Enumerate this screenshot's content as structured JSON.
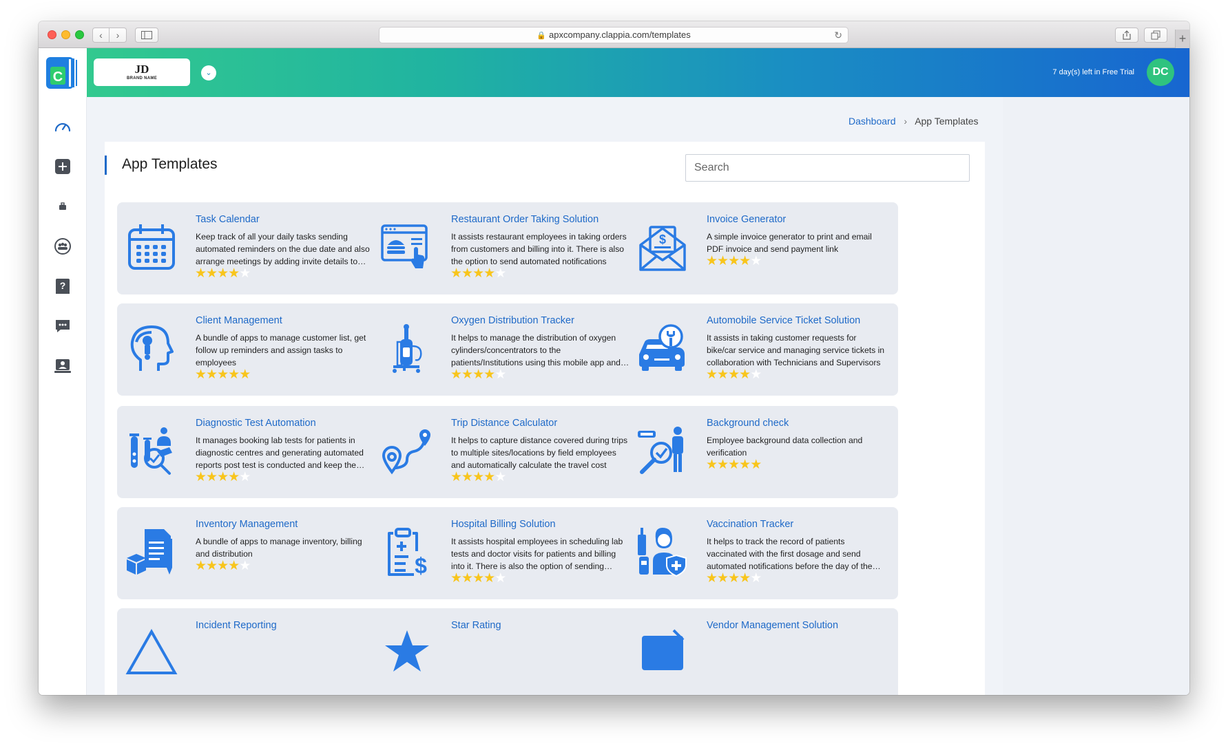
{
  "browser": {
    "url": "apxcompany.clappia.com/templates"
  },
  "header": {
    "brand_mark": "JD",
    "brand_name": "BRAND NAME",
    "trial_text": "7 day(s) left in Free Trial",
    "avatar_initials": "DC"
  },
  "breadcrumb": {
    "dashboard": "Dashboard",
    "current": "App Templates"
  },
  "main": {
    "title": "App Templates",
    "search_placeholder": "Search"
  },
  "colors": {
    "accent": "#1f6ac8",
    "star": "#f8c51c",
    "avatar": "#2fc37f",
    "icon_blue": "#2a7be4"
  },
  "templates": [
    {
      "title": "Task Calendar",
      "desc": "Keep track of all your daily tasks sending automated reminders on the due date and also arrange meetings by adding invite details to calendar",
      "rating": 4,
      "icon": "calendar-icon"
    },
    {
      "title": "Restaurant Order Taking Solution",
      "desc": "It assists restaurant employees in taking orders from customers and billing into it. There is also the option to send automated notifications",
      "rating": 4,
      "icon": "restaurant-order-icon"
    },
    {
      "title": "Invoice Generator",
      "desc": "A simple invoice generator to print and email PDF invoice and send payment link",
      "rating": 4,
      "icon": "invoice-envelope-icon"
    },
    {
      "title": "Client Management",
      "desc": "A bundle of apps to manage customer list, get follow up reminders and assign tasks to employees",
      "rating": 5,
      "icon": "client-head-icon"
    },
    {
      "title": "Oxygen Distribution Tracker",
      "desc": "It helps to manage the distribution of oxygen cylinders/concentrators to the patients/Institutions using this mobile app and web portal",
      "rating": 4,
      "icon": "oxygen-cylinder-icon"
    },
    {
      "title": "Automobile Service Ticket Solution",
      "desc": "It assists in taking customer requests for bike/car service and managing service tickets in collaboration with Technicians and Supervisors",
      "rating": 4,
      "icon": "car-service-icon"
    },
    {
      "title": "Diagnostic Test Automation",
      "desc": "It manages booking lab tests for patients in diagnostic centres and generating automated reports post test is conducted and keep the records",
      "rating": 4,
      "icon": "lab-test-icon"
    },
    {
      "title": "Trip Distance Calculator",
      "desc": "It helps to capture distance covered during trips to multiple sites/locations by field employees and automatically calculate the travel cost",
      "rating": 4,
      "icon": "route-pin-icon"
    },
    {
      "title": "Background check",
      "desc": "Employee background data collection and verification",
      "rating": 5,
      "icon": "background-check-icon"
    },
    {
      "title": "Inventory Management",
      "desc": "A bundle of apps to manage inventory, billing and distribution",
      "rating": 4,
      "icon": "inventory-icon"
    },
    {
      "title": "Hospital Billing Solution",
      "desc": "It assists hospital employees in scheduling lab tests and doctor visits for patients and billing into it. There is also the option of sending notifications",
      "rating": 4,
      "icon": "hospital-bill-icon"
    },
    {
      "title": "Vaccination Tracker",
      "desc": "It helps to track the record of patients vaccinated with the first dosage and send automated notifications before the day of the second dose",
      "rating": 4,
      "icon": "vaccination-icon"
    },
    {
      "title": "Incident Reporting",
      "desc": "",
      "rating": 0,
      "icon": "incident-icon"
    },
    {
      "title": "Star Rating",
      "desc": "",
      "rating": 0,
      "icon": "star-rating-icon"
    },
    {
      "title": "Vendor Management Solution",
      "desc": "",
      "rating": 0,
      "icon": "vendor-icon"
    }
  ]
}
